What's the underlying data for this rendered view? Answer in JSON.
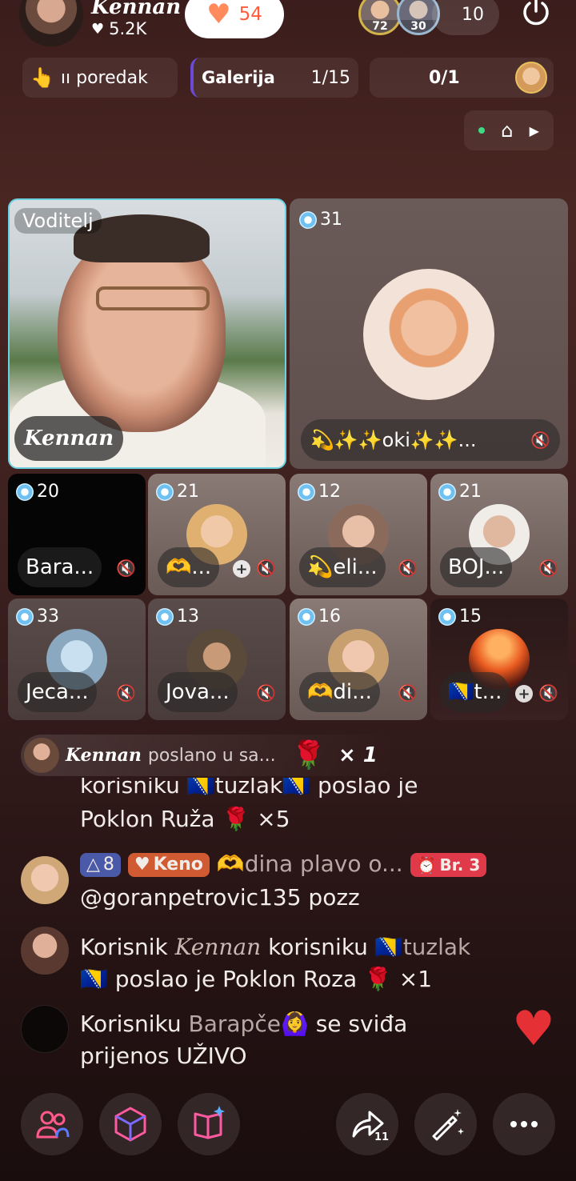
{
  "header": {
    "host_name": "Kennan",
    "host_likes": "5.2K",
    "follow_count": "54",
    "viewer_badges": [
      "72",
      "30"
    ],
    "viewer_count": "10"
  },
  "pills": {
    "ranking": "ıı poredak",
    "gallery_label": "Galerija",
    "gallery_count": "1/15",
    "task_count": "0/1"
  },
  "host_tile": {
    "tag": "Voditelj",
    "name": "Kennan"
  },
  "big_guest": {
    "level": "31",
    "name": "💫✨✨oki✨✨..."
  },
  "guests": [
    {
      "level": "20",
      "name": "Bara..."
    },
    {
      "level": "21",
      "name": "🫶..."
    },
    {
      "level": "12",
      "name": "💫eli..."
    },
    {
      "level": "21",
      "name": "BOJ..."
    },
    {
      "level": "33",
      "name": "Jeca..."
    },
    {
      "level": "13",
      "name": "Jova..."
    },
    {
      "level": "16",
      "name": "🫶di..."
    },
    {
      "level": "15",
      "name": "🇧🇦t..."
    }
  ],
  "gift_banner": {
    "name": "Kennan",
    "text": "poslano u sa...",
    "multiplier": "× 1"
  },
  "comments": {
    "c0_line1": "korisniku 🇧🇦tuzlak🇧🇦 poslao je",
    "c0_line2": "Poklon Ruža 🌹 ×5",
    "c1_level": "8",
    "c1_fan": "Keno",
    "c1_name": "🫶dina plavo o...",
    "c1_br": "Br. 3",
    "c1_text": "@goranpetrovic135 pozz",
    "c2_a": "Korisnik",
    "c2_name": "Kennan",
    "c2_b": "korisniku",
    "c2_c": "🇧🇦tuzlak",
    "c2_line2": "🇧🇦 poslao je Poklon Roza 🌹 ×1",
    "c3_a": "Korisniku",
    "c3_name": "Barapče🙆‍♀️",
    "c3_b": "se sviđa",
    "c3_line2": "prijenos UŽIVO"
  },
  "toolbar": {
    "share_count": "11"
  },
  "colors": {
    "accent_heart": "#e53035",
    "level_badge": "#4a5aa8",
    "fan_badge": "#d05a32",
    "host_border": "#6ad0e0"
  }
}
